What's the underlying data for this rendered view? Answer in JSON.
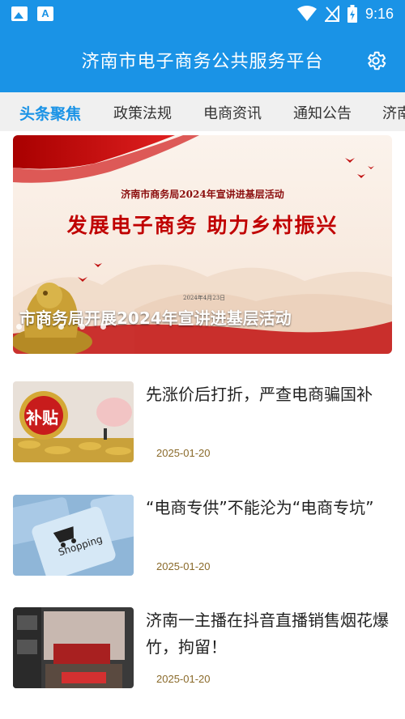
{
  "status_bar": {
    "time": "9:16",
    "icons": [
      "image-icon",
      "font-a-icon",
      "wifi-icon",
      "no-signal-icon",
      "battery-charging-icon"
    ]
  },
  "header": {
    "title": "济南市电子商务公共服务平台",
    "settings_icon": "gear-icon"
  },
  "tabs": [
    {
      "label": "头条聚焦",
      "active": true
    },
    {
      "label": "政策法规",
      "active": false
    },
    {
      "label": "电商资讯",
      "active": false
    },
    {
      "label": "通知公告",
      "active": false
    },
    {
      "label": "济南",
      "active": false
    }
  ],
  "banner": {
    "heading": "济南市商务局2024年宣讲进基层活动",
    "slogan": "发展电子商务  助力乡村振兴",
    "date": "2024年4月23日",
    "caption": "市商务局开展2024年宣讲进基层活动",
    "dot_count": 5
  },
  "news": [
    {
      "title": "先涨价后打折，严查电商骗国补",
      "date": "2025-01-20",
      "thumb_text": "补贴"
    },
    {
      "title": "“电商专供”不能沦为“电商专坑”",
      "date": "2025-01-20",
      "thumb_text": "Shopping"
    },
    {
      "title": "济南一主播在抖音直播销售烟花爆竹，拘留！",
      "date": "2025-01-20",
      "thumb_text": ""
    }
  ],
  "colors": {
    "primary": "#1a93e6",
    "tab_bar_bg": "#f0f0f0",
    "date_text": "#8a6a2a",
    "banner_red": "#c00000"
  }
}
